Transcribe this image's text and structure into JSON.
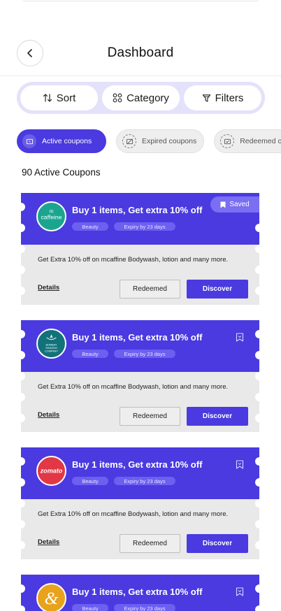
{
  "header": {
    "title": "Dashboard"
  },
  "segmented": [
    {
      "label": "Sort",
      "icon": "sort-icon"
    },
    {
      "label": "Category",
      "icon": "category-grid-icon"
    },
    {
      "label": "Filters",
      "icon": "filter-icon"
    }
  ],
  "chips": [
    {
      "label": "Active coupons",
      "active": true
    },
    {
      "label": "Expired coupons",
      "active": false
    },
    {
      "label": "Redeemed coupons",
      "active": false
    }
  ],
  "count_text": "90 Active Coupons",
  "colors": {
    "accent": "#4a3ae0",
    "accent_light": "#e4e1fb",
    "ticket_gray": "#e9e9e9"
  },
  "coupons": [
    {
      "brand": "mcaffeine",
      "logo_text_top": "m",
      "logo_text": "caffeine",
      "logo_bg": "#1aa58f",
      "title": "Buy 1 items, Get extra 10% off",
      "category": "Beauty",
      "expiry": "Expiry by 23 days",
      "saved": true,
      "saved_label": "Saved",
      "description": "Get Extra 10% off on mcaffine Bodywash, lotion and many more.",
      "details_label": "Details",
      "redeemed_label": "Redeemed",
      "discover_label": "Discover"
    },
    {
      "brand": "bombay shaving company",
      "logo_text_top": "",
      "logo_text": "BOMBAY SHAVING COMPANY",
      "logo_bg": "#12727a",
      "title": "Buy 1 items, Get extra 10% off",
      "category": "Beauty",
      "expiry": "Expiry by 23 days",
      "saved": false,
      "saved_label": "",
      "description": "Get Extra 10% off on mcaffine Bodywash, lotion and many more.",
      "details_label": "Details",
      "redeemed_label": "Redeemed",
      "discover_label": "Discover"
    },
    {
      "brand": "zomato",
      "logo_text_top": "",
      "logo_text": "zomato",
      "logo_bg": "#e23744",
      "title": "Buy 1 items, Get extra 10% off",
      "category": "Beauty",
      "expiry": "Expiry by 23 days",
      "saved": false,
      "saved_label": "",
      "description": "Get Extra 10% off on mcaffine Bodywash, lotion and many more.",
      "details_label": "Details",
      "redeemed_label": "Redeemed",
      "discover_label": "Discover"
    },
    {
      "brand": "ampersand",
      "logo_text_top": "",
      "logo_text": "&",
      "logo_bg": "#e8a21c",
      "title": "Buy 1 items, Get extra 10% off",
      "category": "Beauty",
      "expiry": "Expiry by 23 days",
      "saved": false,
      "saved_label": "",
      "description": "",
      "details_label": "",
      "redeemed_label": "",
      "discover_label": ""
    }
  ]
}
